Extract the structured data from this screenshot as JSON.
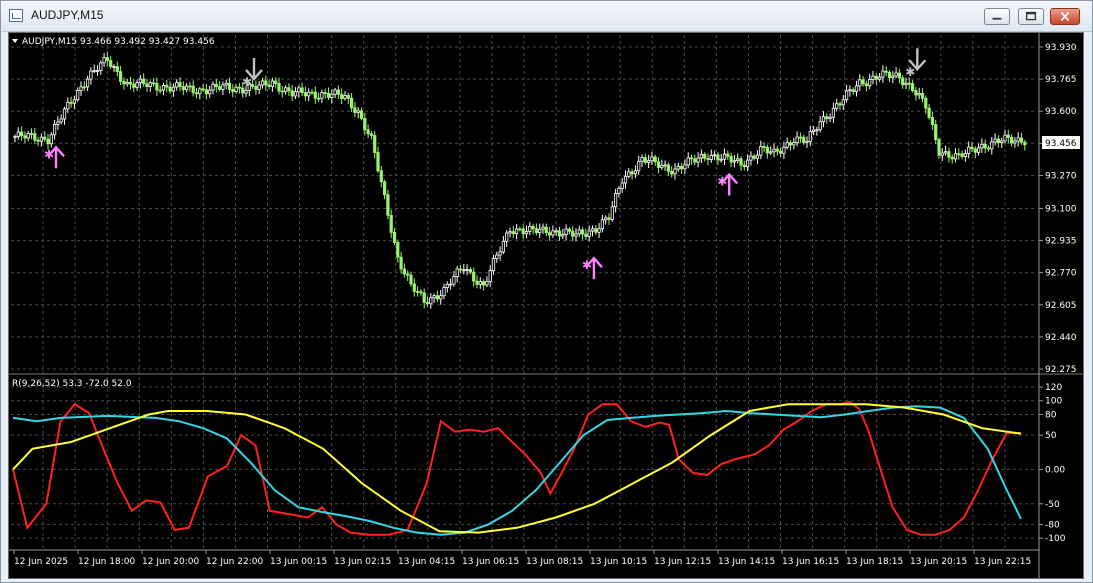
{
  "window": {
    "title": "AUDJPY,M15",
    "icons": {
      "app": "chart-window-icon",
      "minimize": "minimize-icon",
      "maximize": "maximize-icon",
      "close": "close-icon"
    }
  },
  "colors": {
    "background": "#000000",
    "grid": "#4a4a4a",
    "bull_candle": "#ffffff",
    "bear_candle": "#9bf56c",
    "arrow_up": "#ff80ff",
    "arrow_down": "#c0c0c0",
    "series_red": "#ff2020",
    "series_cyan": "#33d6e6",
    "series_yellow": "#ffff33"
  },
  "chart_data": [
    {
      "type": "candlestick",
      "info_label": "AUDJPY,M15  93.466 93.492 93.427 93.456",
      "current_price": "93.456",
      "ylim": [
        92.275,
        93.93
      ],
      "y_ticks": [
        "93.930",
        "93.765",
        "93.600",
        "93.435",
        "93.270",
        "93.100",
        "92.935",
        "92.770",
        "92.605",
        "92.440",
        "92.275"
      ],
      "close_path": [
        [
          0,
          93.47
        ],
        [
          10,
          93.46
        ],
        [
          16,
          93.62
        ],
        [
          22,
          93.78
        ],
        [
          28,
          93.86
        ],
        [
          34,
          93.74
        ],
        [
          44,
          93.73
        ],
        [
          54,
          93.71
        ],
        [
          64,
          93.72
        ],
        [
          74,
          93.72
        ],
        [
          78,
          93.75
        ],
        [
          84,
          93.69
        ],
        [
          94,
          93.69
        ],
        [
          100,
          93.67
        ],
        [
          104,
          93.6
        ],
        [
          108,
          93.45
        ],
        [
          112,
          93.15
        ],
        [
          116,
          92.85
        ],
        [
          120,
          92.7
        ],
        [
          124,
          92.62
        ],
        [
          130,
          92.68
        ],
        [
          136,
          92.8
        ],
        [
          142,
          92.7
        ],
        [
          146,
          92.85
        ],
        [
          150,
          93.0
        ],
        [
          156,
          92.98
        ],
        [
          162,
          92.99
        ],
        [
          170,
          92.96
        ],
        [
          176,
          93.0
        ],
        [
          180,
          93.05
        ],
        [
          184,
          93.25
        ],
        [
          190,
          93.35
        ],
        [
          200,
          93.3
        ],
        [
          210,
          93.38
        ],
        [
          220,
          93.33
        ],
        [
          226,
          93.4
        ],
        [
          230,
          93.38
        ],
        [
          236,
          93.46
        ],
        [
          240,
          93.44
        ],
        [
          244,
          93.55
        ],
        [
          250,
          93.64
        ],
        [
          256,
          93.75
        ],
        [
          262,
          93.78
        ],
        [
          268,
          93.78
        ],
        [
          272,
          93.72
        ],
        [
          276,
          93.62
        ],
        [
          280,
          93.4
        ],
        [
          286,
          93.36
        ],
        [
          292,
          93.42
        ],
        [
          300,
          93.45
        ],
        [
          306,
          93.456
        ]
      ],
      "signals": [
        {
          "type": "buy",
          "bar": 10,
          "price": 93.43
        },
        {
          "type": "sell",
          "bar": 70,
          "price": 93.74
        },
        {
          "type": "buy",
          "bar": 173,
          "price": 92.86
        },
        {
          "type": "buy",
          "bar": 214,
          "price": 93.29
        },
        {
          "type": "sell",
          "bar": 271,
          "price": 93.79
        }
      ],
      "x_labels": [
        "12 Jun 2025",
        "12 Jun 18:00",
        "12 Jun 20:00",
        "12 Jun 22:00",
        "13 Jun 00:15",
        "13 Jun 02:15",
        "13 Jun 04:15",
        "13 Jun 06:15",
        "13 Jun 08:15",
        "13 Jun 10:15",
        "13 Jun 12:15",
        "13 Jun 14:15",
        "13 Jun 16:15",
        "13 Jun 18:15",
        "13 Jun 20:15",
        "13 Jun 22:15"
      ]
    },
    {
      "type": "line",
      "indicator_label": "R(9,26,52) 53.3 -72.0 52.0",
      "ylim": [
        -110,
        120
      ],
      "y_ticks": [
        "120",
        "100",
        "80",
        "50",
        "0.00",
        "-50",
        "-80",
        "-100"
      ],
      "series": [
        {
          "color": "#ff2020",
          "points": [
            [
              0,
              0
            ],
            [
              6,
              -85
            ],
            [
              14,
              -50
            ],
            [
              20,
              70
            ],
            [
              26,
              95
            ],
            [
              32,
              82
            ],
            [
              38,
              30
            ],
            [
              44,
              -20
            ],
            [
              50,
              -60
            ],
            [
              56,
              -45
            ],
            [
              62,
              -48
            ],
            [
              68,
              -88
            ],
            [
              74,
              -85
            ],
            [
              82,
              -10
            ],
            [
              90,
              5
            ],
            [
              96,
              50
            ],
            [
              102,
              35
            ],
            [
              108,
              -60
            ],
            [
              116,
              -65
            ],
            [
              124,
              -70
            ],
            [
              130,
              -55
            ],
            [
              136,
              -80
            ],
            [
              142,
              -92
            ],
            [
              150,
              -95
            ],
            [
              158,
              -95
            ],
            [
              166,
              -88
            ],
            [
              174,
              -20
            ],
            [
              180,
              70
            ],
            [
              186,
              55
            ],
            [
              192,
              58
            ],
            [
              198,
              55
            ],
            [
              204,
              60
            ],
            [
              210,
              40
            ],
            [
              216,
              20
            ],
            [
              222,
              -5
            ],
            [
              226,
              -35
            ],
            [
              230,
              -10
            ],
            [
              236,
              30
            ],
            [
              242,
              80
            ],
            [
              248,
              95
            ],
            [
              254,
              95
            ],
            [
              260,
              70
            ],
            [
              266,
              62
            ],
            [
              272,
              68
            ],
            [
              276,
              65
            ],
            [
              280,
              15
            ],
            [
              286,
              -5
            ],
            [
              292,
              -8
            ],
            [
              298,
              8
            ],
            [
              304,
              15
            ],
            [
              312,
              22
            ],
            [
              318,
              35
            ],
            [
              324,
              58
            ],
            [
              330,
              70
            ],
            [
              336,
              85
            ],
            [
              342,
              95
            ],
            [
              348,
              95
            ],
            [
              352,
              98
            ],
            [
              356,
              88
            ],
            [
              360,
              55
            ],
            [
              364,
              10
            ],
            [
              370,
              -55
            ],
            [
              376,
              -88
            ],
            [
              382,
              -95
            ],
            [
              388,
              -95
            ],
            [
              394,
              -88
            ],
            [
              400,
              -70
            ],
            [
              406,
              -30
            ],
            [
              412,
              15
            ],
            [
              418,
              53
            ],
            [
              424,
              53
            ]
          ]
        },
        {
          "color": "#33d6e6",
          "points": [
            [
              0,
              75
            ],
            [
              10,
              70
            ],
            [
              20,
              75
            ],
            [
              40,
              78
            ],
            [
              60,
              75
            ],
            [
              70,
              70
            ],
            [
              80,
              60
            ],
            [
              90,
              45
            ],
            [
              100,
              10
            ],
            [
              110,
              -30
            ],
            [
              120,
              -55
            ],
            [
              130,
              -62
            ],
            [
              140,
              -68
            ],
            [
              150,
              -75
            ],
            [
              160,
              -85
            ],
            [
              170,
              -92
            ],
            [
              180,
              -95
            ],
            [
              190,
              -92
            ],
            [
              200,
              -80
            ],
            [
              210,
              -60
            ],
            [
              220,
              -30
            ],
            [
              230,
              10
            ],
            [
              240,
              50
            ],
            [
              250,
              72
            ],
            [
              260,
              75
            ],
            [
              270,
              78
            ],
            [
              280,
              80
            ],
            [
              290,
              82
            ],
            [
              300,
              85
            ],
            [
              310,
              82
            ],
            [
              320,
              80
            ],
            [
              330,
              78
            ],
            [
              340,
              76
            ],
            [
              350,
              80
            ],
            [
              360,
              85
            ],
            [
              370,
              90
            ],
            [
              380,
              92
            ],
            [
              390,
              90
            ],
            [
              400,
              75
            ],
            [
              410,
              30
            ],
            [
              418,
              -30
            ],
            [
              424,
              -72
            ]
          ]
        },
        {
          "color": "#ffff33",
          "points": [
            [
              0,
              0
            ],
            [
              10,
              30
            ],
            [
              30,
              40
            ],
            [
              50,
              60
            ],
            [
              70,
              80
            ],
            [
              80,
              85
            ],
            [
              100,
              85
            ],
            [
              120,
              80
            ],
            [
              140,
              60
            ],
            [
              160,
              30
            ],
            [
              180,
              -20
            ],
            [
              200,
              -60
            ],
            [
              220,
              -90
            ],
            [
              240,
              -92
            ],
            [
              260,
              -85
            ],
            [
              280,
              -70
            ],
            [
              300,
              -50
            ],
            [
              320,
              -20
            ],
            [
              340,
              10
            ],
            [
              360,
              50
            ],
            [
              380,
              85
            ],
            [
              400,
              95
            ],
            [
              420,
              95
            ],
            [
              440,
              95
            ],
            [
              460,
              90
            ],
            [
              480,
              80
            ],
            [
              500,
              60
            ],
            [
              520,
              52
            ]
          ]
        }
      ]
    }
  ]
}
